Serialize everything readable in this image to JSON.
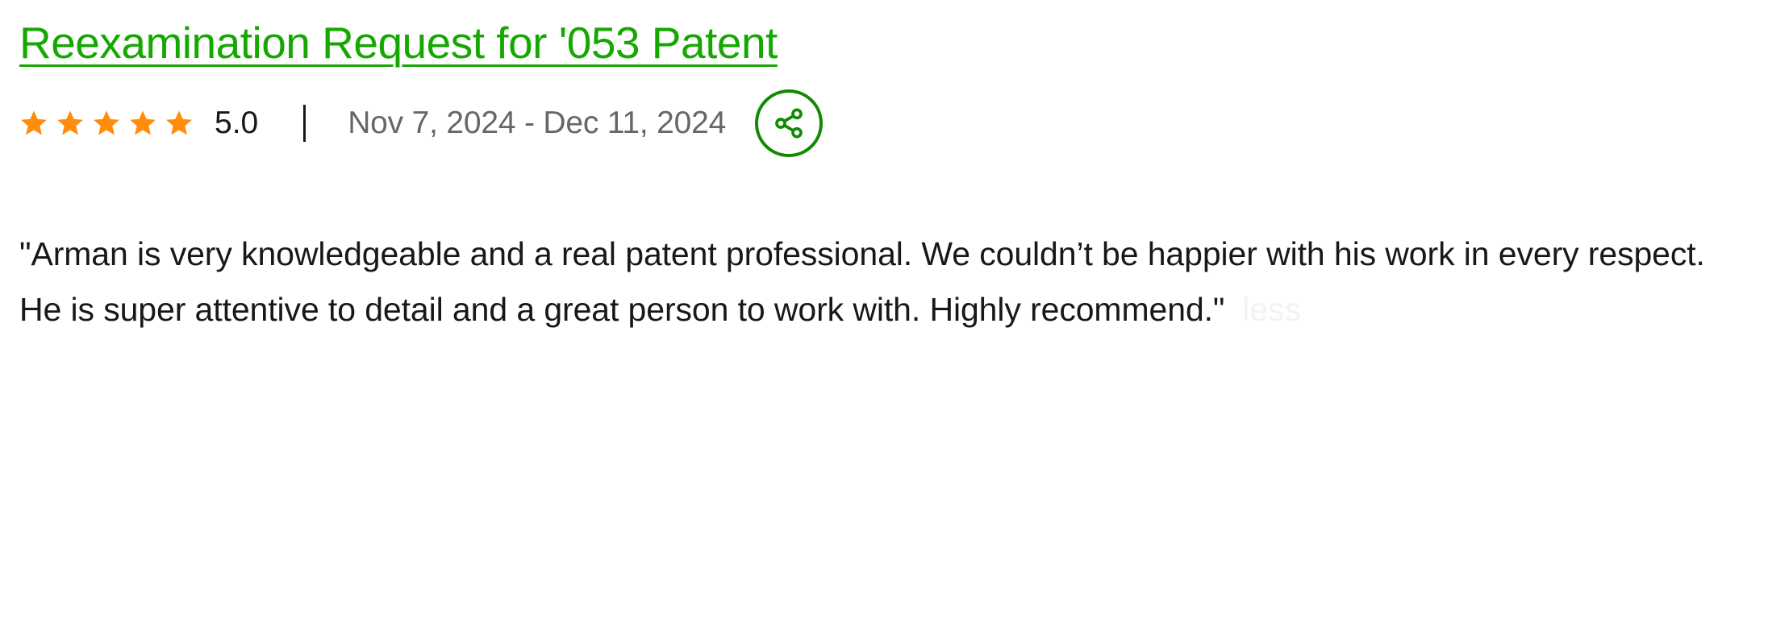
{
  "review": {
    "title": "Reexamination Request for '053 Patent",
    "rating_value": "5.0",
    "star_count": 5,
    "date_range": "Nov 7, 2024 - Dec 11, 2024",
    "quote": "\"Arman is very knowledgeable and a real patent professional. We couldn’t be happier with his work in every respect. He is super attentive to detail and a great person to work with. Highly recommend.\"",
    "less_label": "less"
  },
  "icons": {
    "star": "star-icon",
    "share": "share-icon"
  },
  "colors": {
    "title_green": "#14a800",
    "share_green": "#108a00",
    "star_orange": "#ff8c0a",
    "text": "#181818",
    "muted": "#676767"
  }
}
